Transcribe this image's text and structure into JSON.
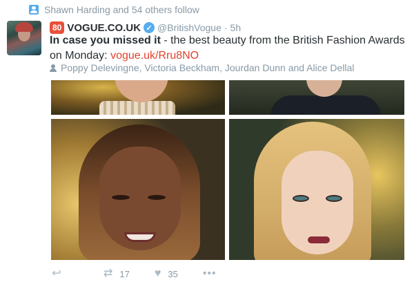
{
  "social_context": {
    "text": "Shawn Harding and 54 others follow"
  },
  "tweet": {
    "badge": "80",
    "display_name": "VOGUE.CO.UK",
    "handle": "@BritishVogue",
    "separator": "·",
    "time": "5h",
    "text_bold": "In case you missed it",
    "text_rest": " - the best beauty from the British Fashion Awards on Monday: ",
    "link": "vogue.uk/Rru8NO",
    "tagged": "Poppy Delevingne, Victoria Beckham, Jourdan Dunn and Alice Dellal"
  },
  "actions": {
    "retweets": "17",
    "likes": "35",
    "more": "•••"
  },
  "icons": {
    "reply": "reply-icon",
    "retweet": "retweet-icon",
    "like": "heart-icon",
    "more": "more-icon",
    "verified": "verified-badge-icon",
    "social_context": "person-icon",
    "tagged": "person-tag-icon"
  },
  "colors": {
    "link": "#e0422c",
    "badge": "#e8503a",
    "verified": "#55acee",
    "muted": "#8899a6",
    "text": "#292f33"
  }
}
